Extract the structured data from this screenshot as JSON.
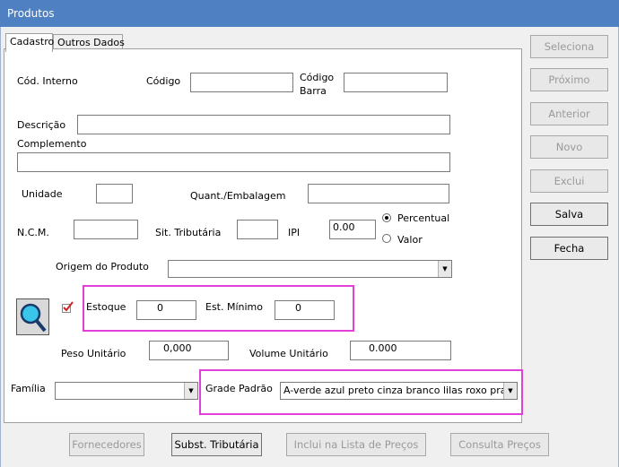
{
  "window": {
    "title": "Produtos"
  },
  "tabs": [
    {
      "label": "Cadastro",
      "active": true
    },
    {
      "label": "Outros Dados",
      "active": false
    }
  ],
  "fields": {
    "cod_interno": {
      "label": "Cód. Interno"
    },
    "codigo": {
      "label": "Código",
      "value": ""
    },
    "codigo_barra": {
      "label_line1": "Código",
      "label_line2": "Barra",
      "value": ""
    },
    "descricao": {
      "label": "Descrição",
      "value": ""
    },
    "complemento": {
      "label": "Complemento",
      "value": ""
    },
    "unidade": {
      "label": "Unidade",
      "value": ""
    },
    "quant_embalagem": {
      "label": "Quant./Embalagem",
      "value": ""
    },
    "ncm": {
      "label": "N.C.M.",
      "value": ""
    },
    "sit_tributaria": {
      "label": "Sit. Tributária",
      "value": ""
    },
    "ipi": {
      "label": "IPI",
      "value": "0.00"
    },
    "ipi_mode": {
      "options": [
        "Percentual",
        "Valor"
      ],
      "selected": "Percentual"
    },
    "origem": {
      "label": "Origem do Produto",
      "value": ""
    },
    "estoque": {
      "label": "Estoque",
      "value": "0"
    },
    "est_minimo": {
      "label": "Est. Mínimo",
      "value": "0"
    },
    "peso_unitario": {
      "label": "Peso Unitário",
      "value": "0,000"
    },
    "volume_unitario": {
      "label": "Volume Unitário",
      "value": "0.000"
    },
    "familia": {
      "label": "Família",
      "value": ""
    },
    "grade_padrao": {
      "label": "Grade Padrão",
      "value": "A-verde azul preto cinza branco lilas roxo prata ama"
    }
  },
  "side_buttons": [
    {
      "label": "Seleciona",
      "enabled": false
    },
    {
      "label": "Próximo",
      "enabled": false
    },
    {
      "label": "Anterior",
      "enabled": false
    },
    {
      "label": "Novo",
      "enabled": false
    },
    {
      "label": "Exclui",
      "enabled": false
    },
    {
      "label": "Salva",
      "enabled": true
    },
    {
      "label": "Fecha",
      "enabled": true
    }
  ],
  "bottom_buttons": [
    {
      "label": "Fornecedores",
      "enabled": false
    },
    {
      "label": "Subst. Tributária",
      "enabled": true
    },
    {
      "label": "Inclui na Lista de Preços",
      "enabled": false
    },
    {
      "label": "Consulta Preços",
      "enabled": false
    }
  ],
  "colors": {
    "titlebar": "#4f81c2",
    "highlight": "#e040d8"
  }
}
